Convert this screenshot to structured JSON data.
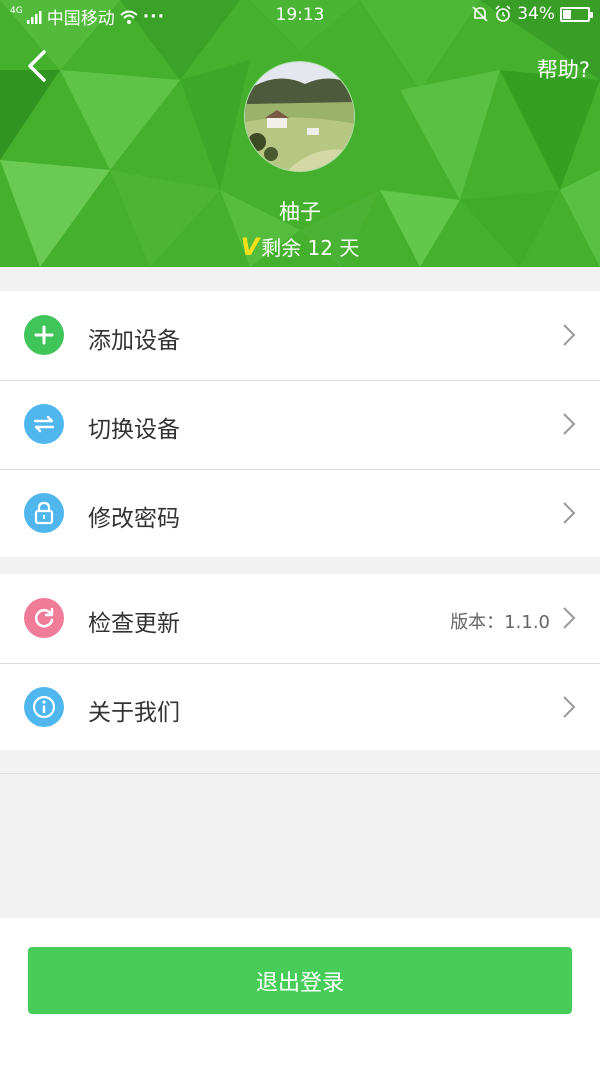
{
  "status_bar": {
    "network_tag": "4G",
    "carrier": "中国移动",
    "time": "19:13",
    "battery_text": "34%",
    "battery_level": 0.34
  },
  "header": {
    "help_label": "帮助?",
    "username": "柚子",
    "vip_badge": "V",
    "remaining": "剩余 12 天"
  },
  "menu_group_1": [
    {
      "label": "添加设备",
      "icon": "plus-icon",
      "color": "#3fc55a"
    },
    {
      "label": "切换设备",
      "icon": "switch-icon",
      "color": "#4fb6ee"
    },
    {
      "label": "修改密码",
      "icon": "lock-icon",
      "color": "#4fb6ee"
    }
  ],
  "menu_group_2": [
    {
      "label": "检查更新",
      "icon": "refresh-icon",
      "color": "#f07c9a",
      "value": "版本：1.1.0"
    },
    {
      "label": "关于我们",
      "icon": "info-icon",
      "color": "#4fb6ee"
    }
  ],
  "logout_label": "退出登录",
  "colors": {
    "accent_green": "#47cc58",
    "header_green": "#3fae2a"
  }
}
